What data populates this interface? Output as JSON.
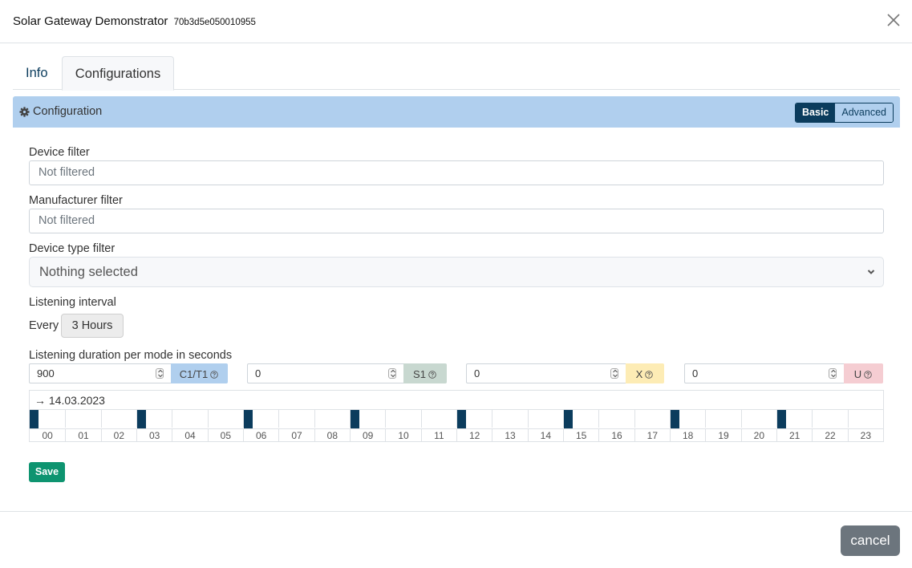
{
  "modal": {
    "title": "Solar Gateway Demonstrator",
    "serial": "70b3d5e050010955",
    "close_icon": "close-icon"
  },
  "tabs": [
    {
      "label": "Info",
      "active": false
    },
    {
      "label": "Configurations",
      "active": true
    }
  ],
  "config_panel": {
    "icon": "gear-icon",
    "title": "Configuration",
    "mode_toggle": [
      {
        "label": "Basic",
        "active": true
      },
      {
        "label": "Advanced",
        "active": false
      }
    ]
  },
  "form": {
    "device_filter": {
      "label": "Device filter",
      "value": "",
      "placeholder": "Not filtered"
    },
    "manufacturer_filter": {
      "label": "Manufacturer filter",
      "value": "",
      "placeholder": "Not filtered"
    },
    "device_type_filter": {
      "label": "Device type filter",
      "selected": "Nothing selected"
    },
    "listening_interval": {
      "label": "Listening interval",
      "prefix": "Every",
      "value": "3 Hours"
    },
    "listening_duration": {
      "label": "Listening duration per mode in seconds",
      "modes": [
        {
          "value": "900",
          "tag": "C1/T1",
          "color": "#b0cfee"
        },
        {
          "value": "0",
          "tag": "S1",
          "color": "#c8d8d0"
        },
        {
          "value": "0",
          "tag": "X",
          "color": "#fdecb5"
        },
        {
          "value": "0",
          "tag": "U",
          "color": "#f5cdd2"
        }
      ]
    }
  },
  "timeline": {
    "date_prefix": "→",
    "date": "14.03.2023",
    "hours": [
      "00",
      "01",
      "02",
      "03",
      "04",
      "05",
      "06",
      "07",
      "08",
      "09",
      "10",
      "11",
      "12",
      "13",
      "14",
      "15",
      "16",
      "17",
      "18",
      "19",
      "20",
      "21",
      "22",
      "23"
    ],
    "active_hours": [
      0,
      3,
      6,
      9,
      12,
      15,
      18,
      21
    ],
    "active_fraction_of_hour": 0.25,
    "bar_color": "#0b3c5d"
  },
  "buttons": {
    "save": "Save",
    "cancel": "cancel"
  }
}
